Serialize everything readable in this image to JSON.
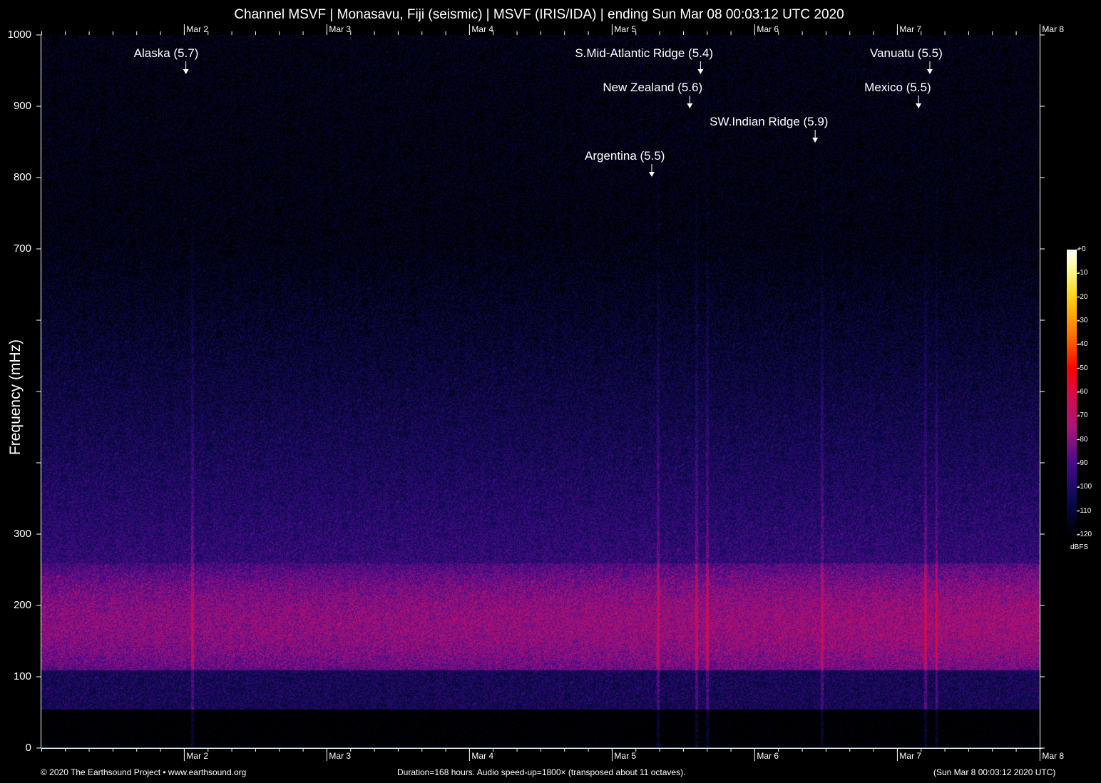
{
  "chart_data": {
    "type": "heatmap",
    "title": "Channel MSVF | Monasavu, Fiji (seismic) | MSVF (IRIS/IDA) | ending Sun Mar 08 00:03:12 UTC 2020",
    "ylabel": "Frequency (mHz)",
    "ylim": [
      0,
      1000
    ],
    "y_tick_labels": [
      "0",
      "100",
      "200",
      "300",
      "",
      "",
      "",
      "700",
      "800",
      "900",
      "1000"
    ],
    "x_range_hours": [
      0,
      168
    ],
    "x_tick_labels": [
      "Mar 2",
      "Mar 3",
      "Mar 4",
      "Mar 5",
      "Mar 6",
      "Mar 7",
      "Mar 8"
    ],
    "colorbar": {
      "unit": "dBFS",
      "range": [
        -120,
        0
      ],
      "tick_labels": [
        "+0",
        "-10",
        "-20",
        "-30",
        "-40",
        "-50",
        "-60",
        "-70",
        "-80",
        "-90",
        "-100",
        "-110",
        "-120"
      ]
    },
    "events": [
      {
        "label": "Alaska (5.7)",
        "hour": 24.2
      },
      {
        "label": "S.Mid-Atlantic Ridge (5.4)",
        "hour": 110.8
      },
      {
        "label": "New Zealand (5.6)",
        "hour": 109.0
      },
      {
        "label": "SW.Indian Ridge (5.9)",
        "hour": 130.1
      },
      {
        "label": "Argentina (5.5)",
        "hour": 102.6
      },
      {
        "label": "Vanuatu (5.5)",
        "hour": 149.4
      },
      {
        "label": "Mexico (5.5)",
        "hour": 147.5
      }
    ]
  },
  "footer": {
    "copyright": "© 2020 The Earthsound Project • www.earthsound.org",
    "info": "Duration=168 hours. Audio speed-up=1800× (transposed about 11 octaves).",
    "timestamp": "(Sun Mar  8 00:03:12 2020 UTC)"
  },
  "colors": {
    "band": "#c0187a",
    "axis": "#ffffff",
    "baseline": "#d020d0"
  }
}
